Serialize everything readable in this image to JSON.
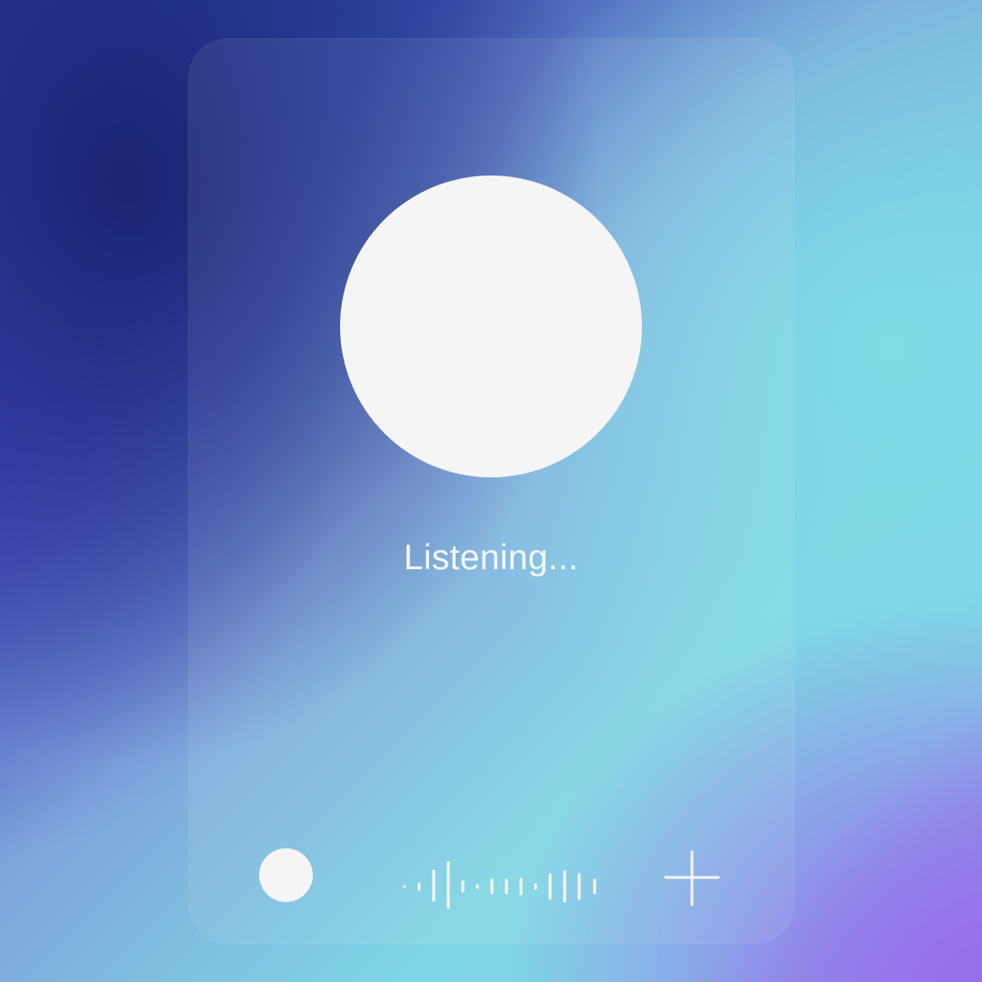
{
  "status": {
    "text": "Listening..."
  },
  "controls": {
    "record_icon": "record-dot-icon",
    "waveform_icon": "audio-waveform-icon",
    "add_icon": "plus-icon"
  },
  "colors": {
    "foreground": "#f5f5f5",
    "deep_navy": "#1e2d82",
    "cyan": "#7fd5e4",
    "violet": "#9a7fe6"
  }
}
